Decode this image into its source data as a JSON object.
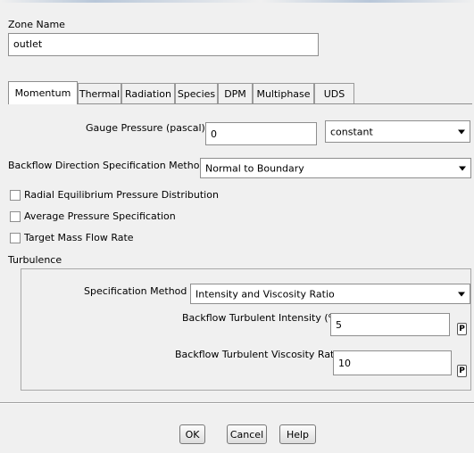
{
  "zone": {
    "label": "Zone Name",
    "value": "outlet"
  },
  "tabs": [
    {
      "label": "Momentum",
      "active": true
    },
    {
      "label": "Thermal"
    },
    {
      "label": "Radiation"
    },
    {
      "label": "Species"
    },
    {
      "label": "DPM"
    },
    {
      "label": "Multiphase"
    },
    {
      "label": "UDS"
    }
  ],
  "momentum": {
    "gauge_pressure_label": "Gauge Pressure (pascal)",
    "gauge_pressure_value": "0",
    "gauge_pressure_method": "constant",
    "backflow_direction_label": "Backflow Direction Specification Method",
    "backflow_direction_value": "Normal to Boundary",
    "checkboxes": [
      {
        "label": "Radial Equilibrium Pressure Distribution",
        "checked": false
      },
      {
        "label": "Average Pressure Specification",
        "checked": false
      },
      {
        "label": "Target Mass Flow Rate",
        "checked": false
      }
    ]
  },
  "turbulence": {
    "group_label": "Turbulence",
    "spec_method_label": "Specification Method",
    "spec_method_value": "Intensity and Viscosity Ratio",
    "intensity_label": "Backflow Turbulent Intensity (%)",
    "intensity_value": "5",
    "viscosity_label": "Backflow Turbulent Viscosity Ratio",
    "viscosity_value": "10",
    "param_button_label": "P"
  },
  "buttons": {
    "ok": "OK",
    "cancel": "Cancel",
    "help": "Help"
  }
}
